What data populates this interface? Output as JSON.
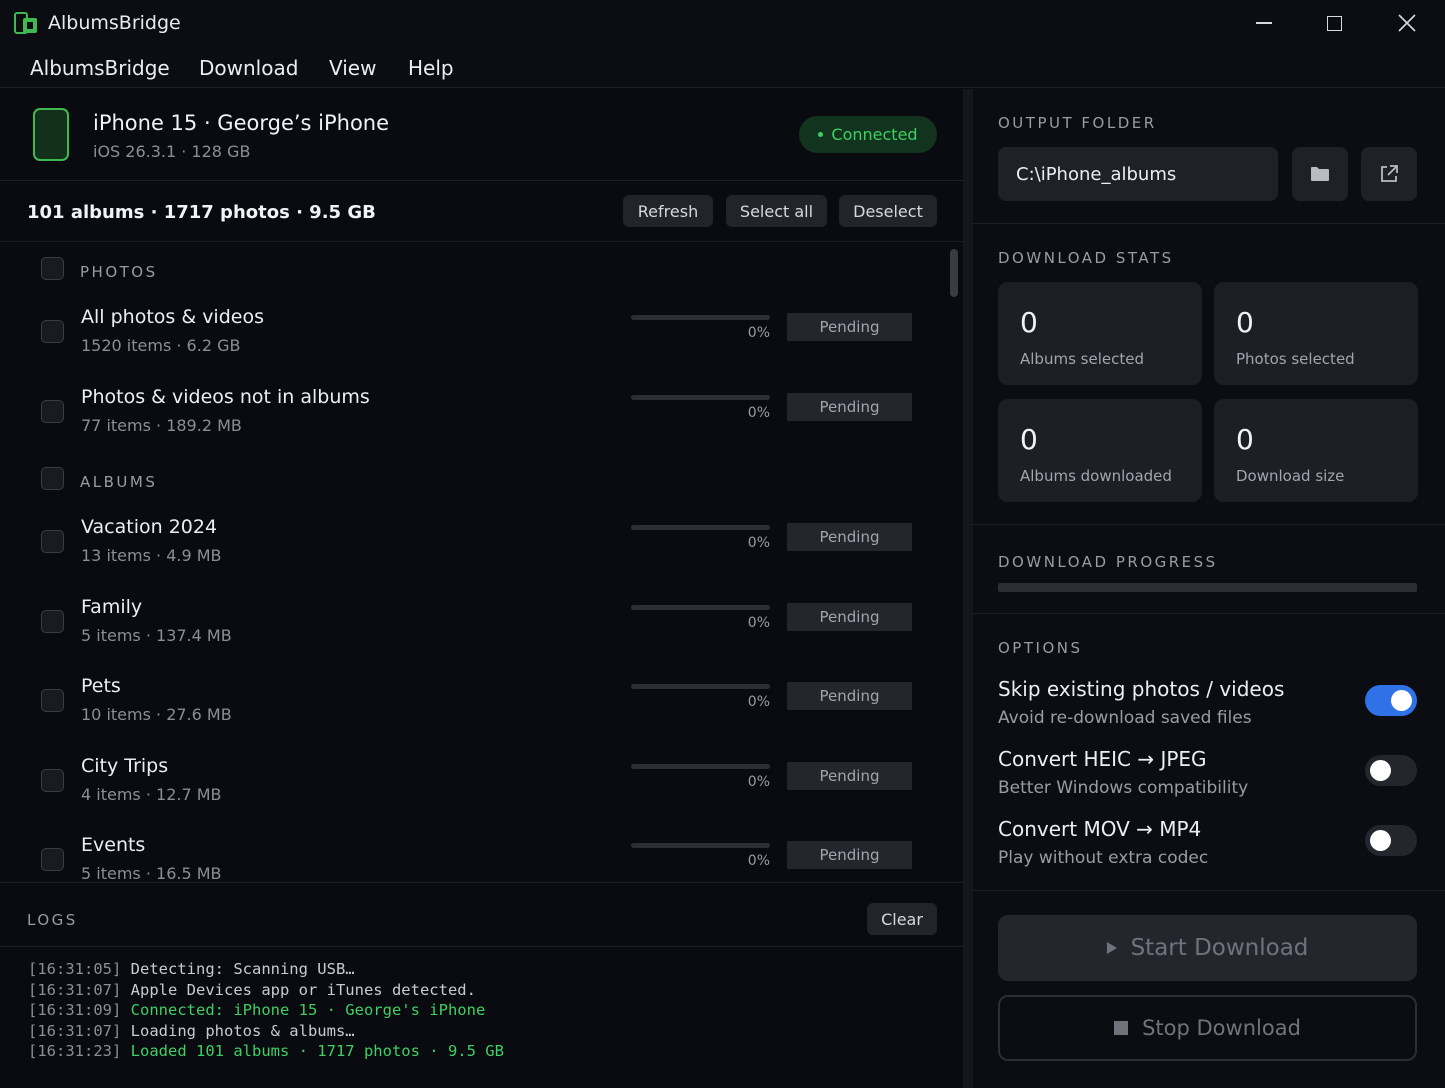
{
  "window": {
    "title": "AlbumsBridge"
  },
  "menu": [
    "AlbumsBridge",
    "Download",
    "View",
    "Help"
  ],
  "device": {
    "name": "iPhone 15 · George’s iPhone",
    "sub": "iOS 26.3.1 · 128 GB",
    "status": "Connected",
    "status_color": "#3fcf63"
  },
  "summary": {
    "text": "101 albums · 1717 photos · 9.5 GB",
    "refresh": "Refresh",
    "select_all": "Select all",
    "deselect": "Deselect"
  },
  "sections": {
    "photos": "PHOTOS",
    "albums": "ALBUMS"
  },
  "photo_rows": [
    {
      "title": "All photos & videos",
      "sub": "1520 items · 6.2 GB",
      "progress": 0,
      "pct": "0%",
      "status": "Pending"
    },
    {
      "title": "Photos & videos not in albums",
      "sub": "77 items · 189.2 MB",
      "progress": 0,
      "pct": "0%",
      "status": "Pending"
    }
  ],
  "album_rows": [
    {
      "title": "Vacation 2024",
      "sub": "13 items · 4.9 MB",
      "progress": 0,
      "pct": "0%",
      "status": "Pending"
    },
    {
      "title": "Family",
      "sub": "5 items · 137.4 MB",
      "progress": 0,
      "pct": "0%",
      "status": "Pending"
    },
    {
      "title": "Pets",
      "sub": "10 items · 27.6 MB",
      "progress": 0,
      "pct": "0%",
      "status": "Pending"
    },
    {
      "title": "City Trips",
      "sub": "4 items · 12.7 MB",
      "progress": 0,
      "pct": "0%",
      "status": "Pending"
    },
    {
      "title": "Events",
      "sub": "5 items · 16.5 MB",
      "progress": 0,
      "pct": "0%",
      "status": "Pending"
    }
  ],
  "logs": {
    "label": "LOGS",
    "clear": "Clear",
    "lines": [
      {
        "ts": "[16:31:05]",
        "msg": "Detecting: Scanning USB…",
        "ok": false
      },
      {
        "ts": "[16:31:07]",
        "msg": "Apple Devices app or iTunes detected.",
        "ok": false
      },
      {
        "ts": "[16:31:09]",
        "msg": "Connected: iPhone 15 · George's iPhone",
        "ok": true
      },
      {
        "ts": "[16:31:07]",
        "msg": "Loading photos & albums…",
        "ok": false
      },
      {
        "ts": "[16:31:23]",
        "msg": "Loaded 101 albums · 1717 photos · 9.5 GB",
        "ok": true
      }
    ]
  },
  "output": {
    "label": "OUTPUT FOLDER",
    "path": "C:\\iPhone_albums"
  },
  "stats": {
    "label": "DOWNLOAD STATS",
    "items": [
      {
        "value": "0",
        "label": "Albums selected"
      },
      {
        "value": "0",
        "label": "Photos selected"
      },
      {
        "value": "0",
        "label": "Albums downloaded"
      },
      {
        "value": "0",
        "label": "Download size"
      }
    ]
  },
  "progress": {
    "label": "DOWNLOAD PROGRESS",
    "value": 0
  },
  "options": {
    "label": "OPTIONS",
    "items": [
      {
        "title": "Skip existing photos / videos",
        "sub": "Avoid re-download saved files",
        "on": true
      },
      {
        "title": "Convert HEIC → JPEG",
        "sub": "Better Windows compatibility",
        "on": false
      },
      {
        "title": "Convert MOV → MP4",
        "sub": "Play without extra codec",
        "on": false
      }
    ]
  },
  "actions": {
    "start": "Start Download",
    "stop": "Stop Download"
  },
  "colors": {
    "accent": "#3fb950",
    "toggle_on": "#2f72e8",
    "background": "#0a0b10"
  }
}
